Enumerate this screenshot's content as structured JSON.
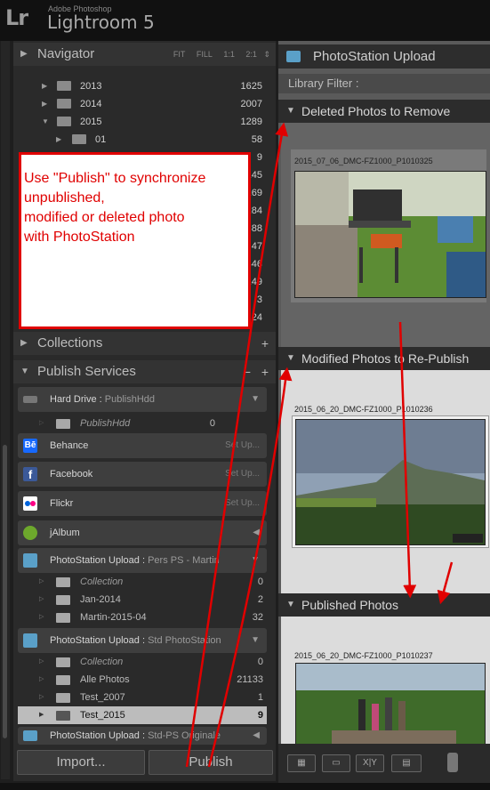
{
  "app": {
    "adobe_label": "Adobe Photoshop",
    "name": "Lightroom 5",
    "logo": "Lr"
  },
  "navigator": {
    "label": "Navigator",
    "options": [
      "FIT",
      "FILL",
      "1:1",
      "2:1"
    ]
  },
  "folders": [
    {
      "name": "2013",
      "count": "1625",
      "open": false
    },
    {
      "name": "2014",
      "count": "2007",
      "open": false
    },
    {
      "name": "2015",
      "count": "1289",
      "open": true
    },
    {
      "name": "01",
      "count": "58",
      "open": false
    }
  ],
  "hidden_counts": [
    "9",
    "145",
    "169",
    "184",
    "88",
    "47",
    "446",
    "149",
    "3",
    "24"
  ],
  "annotation": {
    "text": "Use \"Publish\" to synchronize\nunpublished,\nmodified or deleted photo\nwith PhotoStation"
  },
  "collections": {
    "label": "Collections"
  },
  "publish_services": {
    "label": "Publish Services",
    "hard_drive": {
      "name": "Hard Drive",
      "sub": "PublishHdd"
    },
    "publish_hdd": {
      "name": "PublishHdd",
      "count": "0"
    },
    "behance": {
      "name": "Behance",
      "setup": "Set Up..."
    },
    "facebook": {
      "name": "Facebook",
      "setup": "Set Up..."
    },
    "flickr": {
      "name": "Flickr",
      "setup": "Set Up..."
    },
    "jalbum": {
      "name": "jAlbum"
    },
    "ps1": {
      "name": "PhotoStation Upload",
      "sub": "Pers PS - Martin"
    },
    "ps1_items": [
      {
        "name": "Collection",
        "count": "0",
        "italic": true
      },
      {
        "name": "Jan-2014",
        "count": "2",
        "italic": false
      },
      {
        "name": "Martin-2015-04",
        "count": "32",
        "italic": false
      }
    ],
    "ps2": {
      "name": "PhotoStation Upload",
      "sub": "Std PhotoStation"
    },
    "ps2_items": [
      {
        "name": "Collection",
        "count": "0",
        "italic": true
      },
      {
        "name": "Alle Photos",
        "count": "21133",
        "italic": false
      },
      {
        "name": "Test_2007",
        "count": "1",
        "italic": false
      },
      {
        "name": "Test_2015",
        "count": "9",
        "italic": false
      }
    ],
    "ps3": {
      "name": "PhotoStation Upload",
      "sub": "Std-PS Originale"
    }
  },
  "buttons": {
    "import": "Import...",
    "publish": "Publish"
  },
  "right": {
    "header": "PhotoStation Upload",
    "library_filter": "Library Filter :",
    "sections": {
      "deleted": "Deleted Photos to Remove",
      "modified": "Modified Photos to Re-Publish",
      "published": "Published Photos"
    },
    "photos": {
      "deleted": "2015_07_06_DMC-FZ1000_P1010325",
      "modified": "2015_06_20_DMC-FZ1000_P1010236",
      "published": "2015_06_20_DMC-FZ1000_P1010237"
    }
  },
  "colors": {
    "annotation_red": "#e00000",
    "panel": "#2a2a2a",
    "grid_light": "#dcdcdc"
  }
}
